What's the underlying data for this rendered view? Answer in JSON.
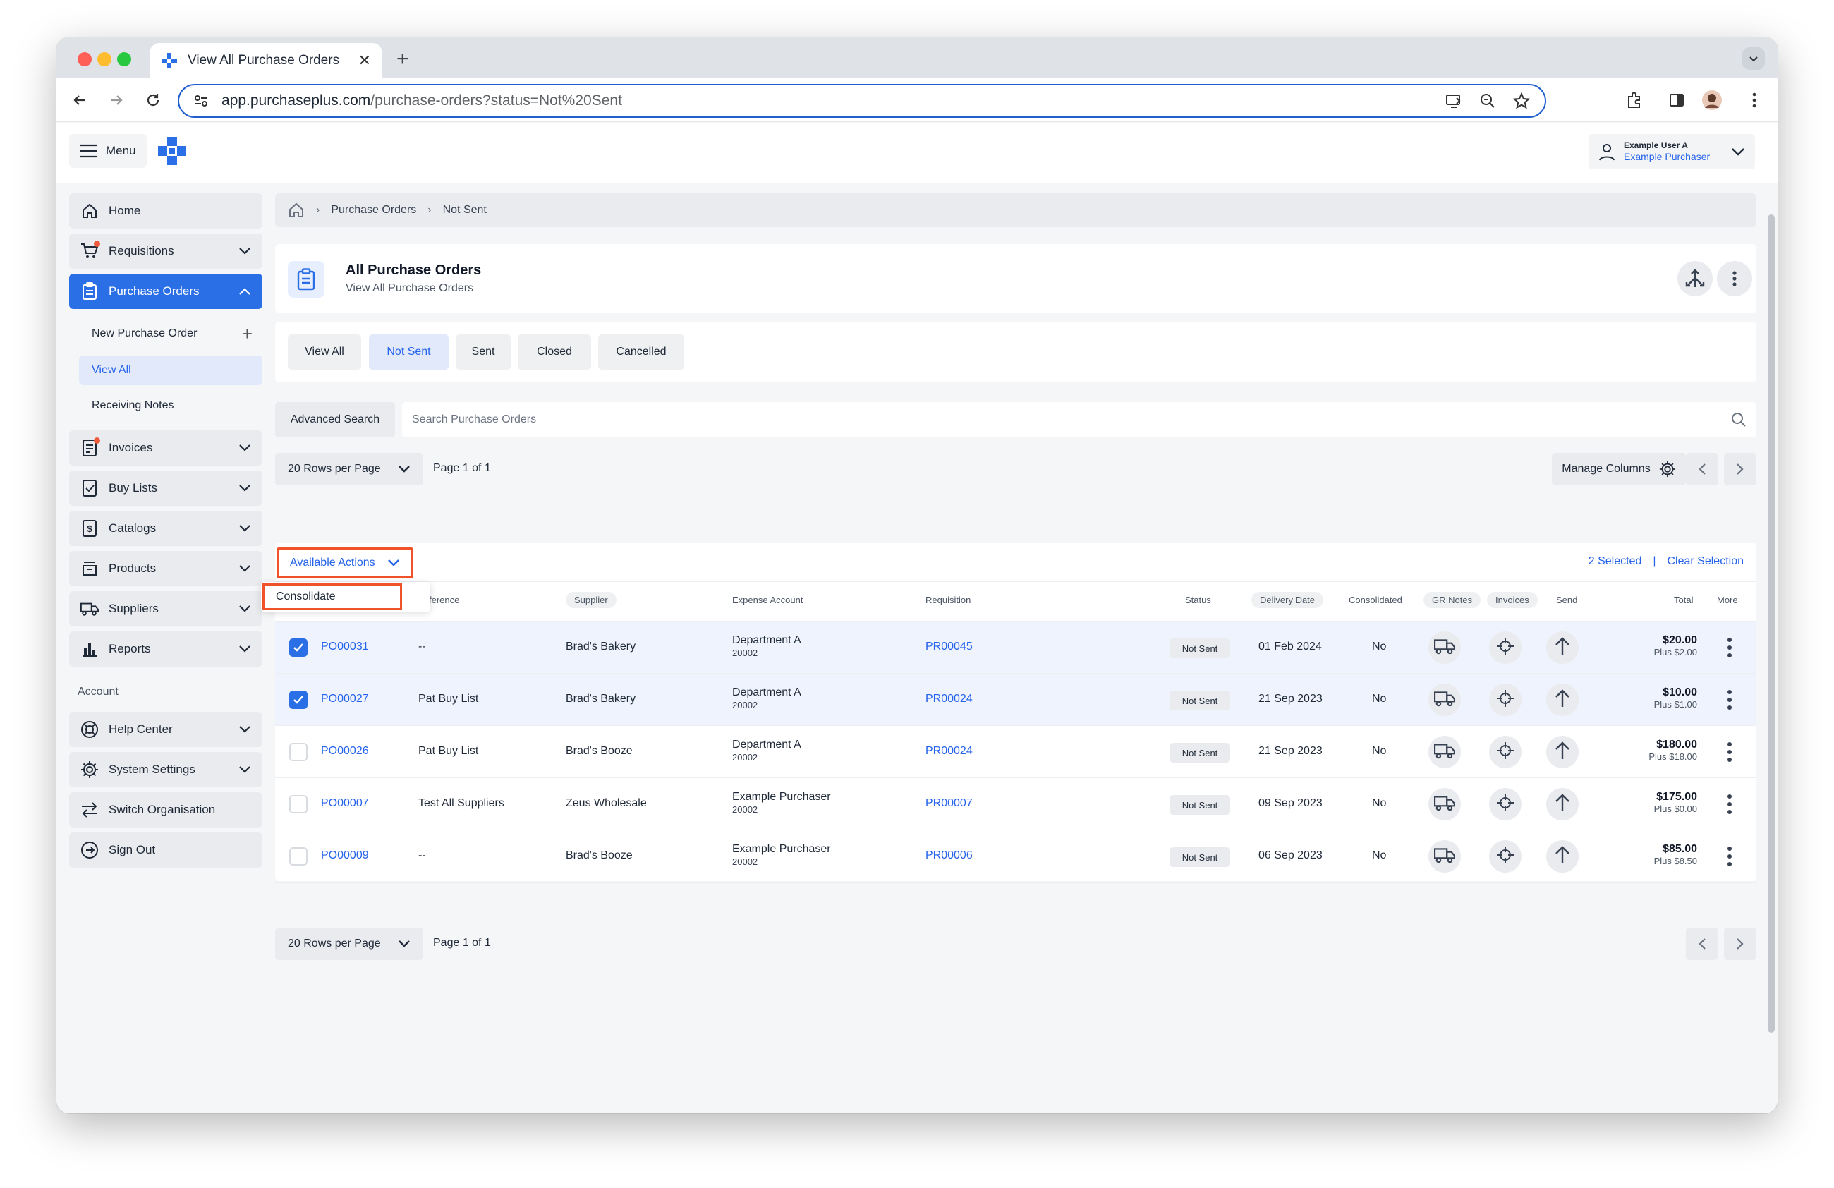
{
  "browser": {
    "tab_title": "View All Purchase Orders",
    "url_host": "app.purchaseplus.com",
    "url_path": "/purchase-orders?status=Not%20Sent"
  },
  "appbar": {
    "menu_label": "Menu",
    "user_name": "Example User A",
    "user_role": "Example Purchaser"
  },
  "sidebar": {
    "items": [
      {
        "label": "Home",
        "icon": "home-icon"
      },
      {
        "label": "Requisitions",
        "icon": "cart-icon"
      },
      {
        "label": "Purchase Orders",
        "icon": "clipboard-icon"
      },
      {
        "label": "Invoices",
        "icon": "invoice-icon"
      },
      {
        "label": "Buy Lists",
        "icon": "checklist-icon"
      },
      {
        "label": "Catalogs",
        "icon": "dollar-doc-icon"
      },
      {
        "label": "Products",
        "icon": "stack-icon"
      },
      {
        "label": "Suppliers",
        "icon": "truck-icon"
      },
      {
        "label": "Reports",
        "icon": "bar-chart-icon"
      }
    ],
    "sub_items": [
      "New Purchase Order",
      "View All",
      "Receiving Notes"
    ],
    "account_section": "Account",
    "account_items": [
      {
        "label": "Help Center",
        "icon": "lifebuoy-icon"
      },
      {
        "label": "System Settings",
        "icon": "gear-icon"
      },
      {
        "label": "Switch Organisation",
        "icon": "swap-icon"
      },
      {
        "label": "Sign Out",
        "icon": "sign-out-icon"
      }
    ]
  },
  "breadcrumb": {
    "items": [
      "Purchase Orders",
      "Not Sent"
    ]
  },
  "header": {
    "title": "All Purchase Orders",
    "subtitle": "View All Purchase Orders"
  },
  "filter_tabs": [
    "View All",
    "Not Sent",
    "Sent",
    "Closed",
    "Cancelled"
  ],
  "search": {
    "advanced_label": "Advanced Search",
    "placeholder": "Search Purchase Orders"
  },
  "pager": {
    "rows_per_page": "20 Rows per Page",
    "page_label": "Page 1 of 1",
    "manage_columns": "Manage Columns"
  },
  "actions": {
    "available_label": "Available Actions",
    "dropdown_item": "Consolidate",
    "selected": "2 Selected",
    "clear": "Clear Selection"
  },
  "table": {
    "columns": {
      "reference": "ference",
      "supplier": "Supplier",
      "expense_account": "Expense Account",
      "requisition": "Requisition",
      "status": "Status",
      "delivery_date": "Delivery Date",
      "consolidated": "Consolidated",
      "gr_notes": "GR Notes",
      "invoices": "Invoices",
      "send": "Send",
      "total": "Total",
      "more": "More"
    },
    "rows": [
      {
        "selected": true,
        "po": "PO00031",
        "reference": "--",
        "supplier": "Brad's Bakery",
        "account": "Department A",
        "account_code": "20002",
        "requisition": "PR00045",
        "status": "Not Sent",
        "delivery": "01 Feb 2024",
        "consolidated": "No",
        "total": "$20.00",
        "tax": "Plus $2.00"
      },
      {
        "selected": true,
        "po": "PO00027",
        "reference": "Pat Buy List",
        "supplier": "Brad's Bakery",
        "account": "Department A",
        "account_code": "20002",
        "requisition": "PR00024",
        "status": "Not Sent",
        "delivery": "21 Sep 2023",
        "consolidated": "No",
        "total": "$10.00",
        "tax": "Plus $1.00"
      },
      {
        "selected": false,
        "po": "PO00026",
        "reference": "Pat Buy List",
        "supplier": "Brad's Booze",
        "account": "Department A",
        "account_code": "20002",
        "requisition": "PR00024",
        "status": "Not Sent",
        "delivery": "21 Sep 2023",
        "consolidated": "No",
        "total": "$180.00",
        "tax": "Plus $18.00"
      },
      {
        "selected": false,
        "po": "PO00007",
        "reference": "Test All Suppliers",
        "supplier": "Zeus Wholesale",
        "account": "Example Purchaser",
        "account_code": "20002",
        "requisition": "PR00007",
        "status": "Not Sent",
        "delivery": "09 Sep 2023",
        "consolidated": "No",
        "total": "$175.00",
        "tax": "Plus $0.00"
      },
      {
        "selected": false,
        "po": "PO00009",
        "reference": "--",
        "supplier": "Brad's Booze",
        "account": "Example Purchaser",
        "account_code": "20002",
        "requisition": "PR00006",
        "status": "Not Sent",
        "delivery": "06 Sep 2023",
        "consolidated": "No",
        "total": "$85.00",
        "tax": "Plus $8.50"
      }
    ]
  },
  "colors": {
    "accent": "#2b6fe6",
    "highlight": "#f0532b"
  }
}
